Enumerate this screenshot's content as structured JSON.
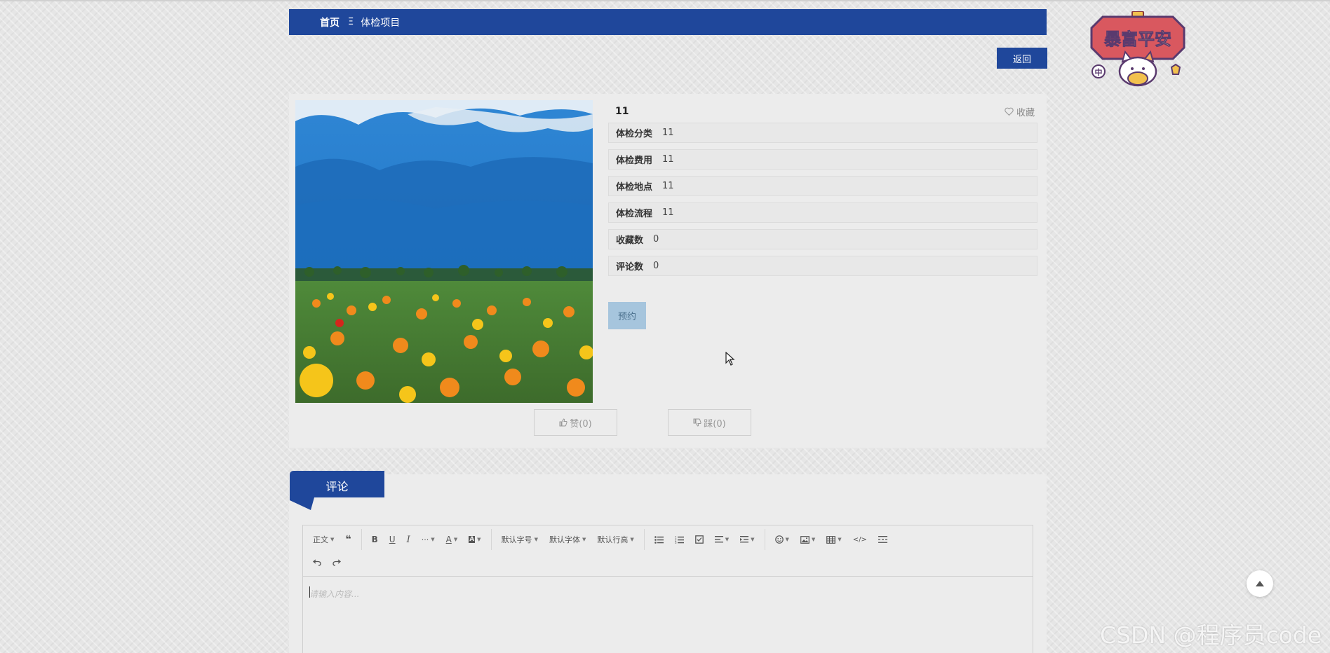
{
  "breadcrumb": {
    "home": "首页",
    "separator": "Ξ",
    "current": "体检项目"
  },
  "back_button": "返回",
  "mascot": {
    "text": "暴富平安",
    "icon": "lucky-cat-icon"
  },
  "item": {
    "title": "11",
    "favorite_label": "收藏",
    "fields": [
      {
        "label": "体检分类",
        "value": "11"
      },
      {
        "label": "体检费用",
        "value": "11"
      },
      {
        "label": "体检地点",
        "value": "11"
      },
      {
        "label": "体检流程",
        "value": "11"
      },
      {
        "label": "收藏数",
        "value": "0"
      },
      {
        "label": "评论数",
        "value": "0"
      }
    ],
    "reserve_button": "预约",
    "like_label": "赞(0)",
    "dislike_label": "踩(0)"
  },
  "comments": {
    "tab_label": "评论",
    "toolbar": {
      "paragraph": "正文",
      "font_size": "默认字号",
      "font_family": "默认字体",
      "line_height": "默认行高"
    },
    "placeholder": "请输入内容..."
  },
  "watermark": "CSDN @程序员code",
  "colors": {
    "primary": "#1f479b",
    "reserve": "#a6c5dd",
    "background": "#e6e6e6"
  }
}
